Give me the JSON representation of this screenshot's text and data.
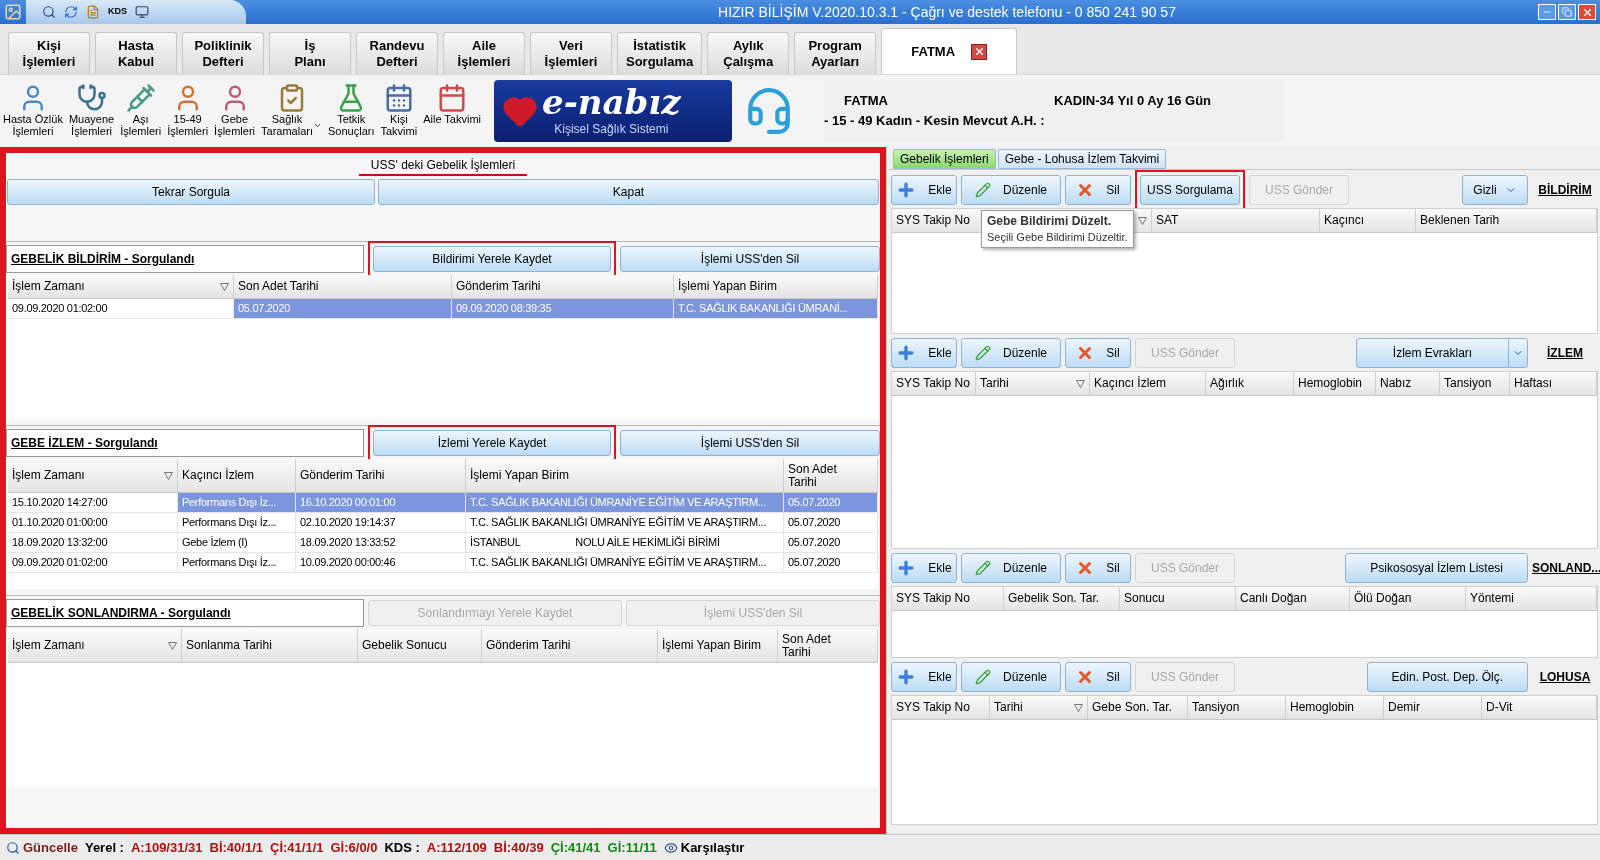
{
  "title_bar": {
    "title": "HIZIR BİLİŞİM V.2020.10.3.1 - Çağrı ve destek telefonu - 0 850 241 90 57",
    "quick_label": "KDS"
  },
  "menu_tabs": [
    {
      "label": "Kişi\nİşlemleri",
      "selected": false
    },
    {
      "label": "Hasta\nKabul",
      "selected": false
    },
    {
      "label": "Poliklinik\nDefteri",
      "selected": false
    },
    {
      "label": "İş\nPlanı",
      "selected": false
    },
    {
      "label": "Randevu\nDefteri",
      "selected": false
    },
    {
      "label": "Aile\nİşlemleri",
      "selected": false
    },
    {
      "label": "Veri\nİşlemleri",
      "selected": false
    },
    {
      "label": "İstatistik\nSorgulama",
      "selected": false
    },
    {
      "label": "Aylık\nÇalışma",
      "selected": false
    },
    {
      "label": "Program\nAyarları",
      "selected": false
    },
    {
      "label": "FATMA",
      "selected": true,
      "closable": true
    }
  ],
  "toolbar": [
    {
      "label": "Hasta Özlük\nİşlemleri",
      "kind": "button"
    },
    {
      "label": "Muayene\nİşlemleri",
      "kind": "button"
    },
    {
      "label": "Aşı\nİşlemleri",
      "kind": "button"
    },
    {
      "label": "15-49\nİşlemleri",
      "kind": "button"
    },
    {
      "label": "Gebe\nİşlemleri",
      "kind": "button"
    },
    {
      "label": "Sağlık\nTaramaları",
      "kind": "dropdown"
    },
    {
      "label": "Tetkik\nSonuçları",
      "kind": "button"
    },
    {
      "label": "Kişi\nTakvimi",
      "kind": "button"
    },
    {
      "label": "Aile Takvimi",
      "kind": "button"
    }
  ],
  "banner": {
    "title": "e-nabız",
    "subtitle": "Kişisel Sağlık Sistemi"
  },
  "patient": {
    "name": "FATMA",
    "info": "KADIN-34 Yıl 0 Ay 16 Gün",
    "status": "- 15 - 49 Kadın - Kesin Mevcut A.H. :"
  },
  "left_panel": {
    "title": "USS' deki Gebelik İşlemleri",
    "highlighted": true,
    "buttons": [
      "Tekrar Sorgula",
      "Kapat"
    ],
    "sections": [
      {
        "title": "GEBELİK BİLDİRİM - Sorgulandı",
        "buttons": [
          {
            "label": "Bildirimi Yerele Kaydet",
            "disabled": false,
            "highlighted": true
          },
          {
            "label": "İşlemi USS'den Sil",
            "disabled": false,
            "highlighted": false
          }
        ],
        "columns": [
          {
            "label": "İşlem Zamanı",
            "sortable": true
          },
          {
            "label": "Son Adet Tarihi",
            "sortable": false
          },
          {
            "label": "Gönderim Tarihi",
            "sortable": false
          },
          {
            "label": "İşlemi Yapan Birim",
            "sortable": false
          }
        ],
        "rows": [
          {
            "selected": true,
            "cells": [
              "09.09.2020 01:02:00",
              "05.07.2020",
              "09.09.2020 08:39:35",
              "T.C. SAĞLIK BAKANLIĞI ÜMRANİ..."
            ]
          }
        ]
      },
      {
        "title": "GEBE İZLEM - Sorgulandı",
        "buttons": [
          {
            "label": "İzlemi Yerele Kaydet",
            "disabled": false,
            "highlighted": true
          },
          {
            "label": "İşlemi USS'den Sil",
            "disabled": false,
            "highlighted": false
          }
        ],
        "columns": [
          {
            "label": "İşlem Zamanı",
            "sortable": true
          },
          {
            "label": "Kaçıncı İzlem",
            "sortable": false
          },
          {
            "label": "Gönderim Tarihi",
            "sortable": false
          },
          {
            "label": "İşlemi Yapan Birim",
            "sortable": false
          },
          {
            "label": "Son Adet\nTarihi",
            "sortable": false
          }
        ],
        "rows": [
          {
            "selected": true,
            "cells": [
              "15.10.2020 14:27:00",
              "Performans Dışı İz...",
              "16.10.2020 00:01:00",
              "T.C. SAĞLIK BAKANLIĞI ÜMRANİYE EĞİTİM VE ARAŞTIRM...",
              "05.07.2020"
            ]
          },
          {
            "selected": false,
            "cells": [
              "01.10.2020 01:00:00",
              "Performans Dışı İz...",
              "02.10.2020 19:14:37",
              "T.C. SAĞLIK BAKANLIĞI ÜMRANİYE EĞİTİM VE ARAŞTIRM...",
              "05.07.2020"
            ]
          },
          {
            "selected": false,
            "cells": [
              "18.09.2020 13:32:00",
              "Gebe İzlem (I)",
              "18.09.2020 13:33:52",
              "İSTANBUL                    NOLU AİLE HEKİMLİĞİ BİRİMİ",
              "05.07.2020"
            ]
          },
          {
            "selected": false,
            "cells": [
              "09.09.2020 01:02:00",
              "Performans Dışı İz...",
              "10.09.2020 00:00:46",
              "T.C. SAĞLIK BAKANLIĞI ÜMRANİYE EĞİTİM VE ARAŞTIRM...",
              "05.07.2020"
            ]
          }
        ]
      },
      {
        "title": "GEBELİK SONLANDIRMA - Sorgulandı",
        "buttons": [
          {
            "label": "Sonlandırmayı Yerele Kaydet",
            "disabled": true,
            "highlighted": false
          },
          {
            "label": "İşlemi USS'den Sil",
            "disabled": true,
            "highlighted": false
          }
        ],
        "columns": [
          {
            "label": "İşlem Zamanı",
            "sortable": true
          },
          {
            "label": "Sonlanma Tarihi",
            "sortable": false
          },
          {
            "label": "Gebelik Sonucu",
            "sortable": false
          },
          {
            "label": "Gönderim Tarihi",
            "sortable": false
          },
          {
            "label": "İşlemi Yapan Birim",
            "sortable": false
          },
          {
            "label": "Son Adet\nTarihi",
            "sortable": false
          }
        ]
      }
    ]
  },
  "right_panel": {
    "tabs": [
      {
        "label": "Gebelik İşlemleri",
        "selected": true
      },
      {
        "label": "Gebe - Lohusa İzlem Takvimi",
        "selected": false
      }
    ],
    "tooltip": {
      "title": "Gebe Bildirimi Düzelt.",
      "text": "Seçili Gebe Bildirimi Düzeltir."
    },
    "sections": [
      {
        "title": "BİLDİRİM",
        "actions": [
          {
            "label": "Ekle",
            "kind": "add",
            "disabled": false,
            "highlighted": false
          },
          {
            "label": "Düzenle",
            "kind": "edit",
            "disabled": false,
            "highlighted": false
          },
          {
            "label": "Sil",
            "kind": "delete",
            "disabled": false,
            "highlighted": false
          },
          {
            "label": "USS Sorgulama",
            "kind": "button",
            "disabled": false,
            "highlighted": true
          },
          {
            "label": "USS Gönder",
            "kind": "button",
            "disabled": true,
            "highlighted": false
          }
        ],
        "extras": [
          {
            "label": "Gizli",
            "kind": "dropdown"
          }
        ],
        "columns": [
          {
            "label": "SYS Takip No",
            "sortable": false
          },
          {
            "sortable": true
          },
          {
            "label": "SAT",
            "sortable": false
          },
          {
            "label": "Kaçıncı",
            "sortable": false
          },
          {
            "label": "Beklenen Tarih",
            "sortable": false
          }
        ]
      },
      {
        "title": "İZLEM",
        "actions": [
          {
            "label": "Ekle",
            "kind": "add",
            "disabled": false,
            "highlighted": false
          },
          {
            "label": "Düzenle",
            "kind": "edit",
            "disabled": false,
            "highlighted": false
          },
          {
            "label": "Sil",
            "kind": "delete",
            "disabled": false,
            "highlighted": false
          },
          {
            "label": "USS Gönder",
            "kind": "button",
            "disabled": true,
            "highlighted": false
          }
        ],
        "extras": [
          {
            "label": "İzlem Evrakları",
            "kind": "split"
          }
        ],
        "columns": [
          {
            "label": "SYS Takip No",
            "sortable": false
          },
          {
            "label": "Tarihi",
            "sortable": true
          },
          {
            "label": "Kaçıncı İzlem",
            "sortable": false
          },
          {
            "label": "Ağırlık",
            "sortable": false
          },
          {
            "label": "Hemoglobin",
            "sortable": false
          },
          {
            "label": "Nabız",
            "sortable": false
          },
          {
            "label": "Tansiyon",
            "sortable": false
          },
          {
            "label": "Haftası",
            "sortable": false
          }
        ]
      },
      {
        "title": "SONLAND...",
        "actions": [
          {
            "label": "Ekle",
            "kind": "add",
            "disabled": false,
            "highlighted": false
          },
          {
            "label": "Düzenle",
            "kind": "edit",
            "disabled": false,
            "highlighted": false
          },
          {
            "label": "Sil",
            "kind": "delete",
            "disabled": false,
            "highlighted": false
          },
          {
            "label": "USS Gönder",
            "kind": "button",
            "disabled": true,
            "highlighted": false
          }
        ],
        "extras": [
          {
            "label": "Psikososyal İzlem Listesi",
            "kind": "button"
          }
        ],
        "columns": [
          {
            "label": "SYS Takip No",
            "sortable": false
          },
          {
            "label": "Gebelik Son. Tar.",
            "sortable": false
          },
          {
            "label": "Sonucu",
            "sortable": false
          },
          {
            "label": "Canlı Doğan",
            "sortable": false
          },
          {
            "label": "Ölü Doğan",
            "sortable": false
          },
          {
            "label": "Yöntemi",
            "sortable": false
          }
        ]
      },
      {
        "title": "LOHUSA",
        "actions": [
          {
            "label": "Ekle",
            "kind": "add",
            "disabled": false,
            "highlighted": false
          },
          {
            "label": "Düzenle",
            "kind": "edit",
            "disabled": false,
            "highlighted": false
          },
          {
            "label": "Sil",
            "kind": "delete",
            "disabled": false,
            "highlighted": false
          },
          {
            "label": "USS Gönder",
            "kind": "button",
            "disabled": true,
            "highlighted": false
          }
        ],
        "extras": [
          {
            "label": "Edin. Post. Dep. Ölç.",
            "kind": "button"
          }
        ],
        "columns": [
          {
            "label": "SYS Takip No",
            "sortable": false
          },
          {
            "label": "Tarihi",
            "sortable": true
          },
          {
            "label": "Gebe Son. Tar.",
            "sortable": false
          },
          {
            "label": "Tansiyon",
            "sortable": false
          },
          {
            "label": "Hemoglobin",
            "sortable": false
          },
          {
            "label": "Demir",
            "sortable": false
          },
          {
            "label": "D-Vit",
            "sortable": false
          }
        ]
      }
    ]
  },
  "status_bar": [
    {
      "text": "Güncelle",
      "color": "#7a1c1c",
      "kind": "refresh"
    },
    {
      "text": "Yerel :",
      "color": "#000000"
    },
    {
      "text": "A:109/31/31",
      "color": "#b01010"
    },
    {
      "text": "Bİ:40/1/1",
      "color": "#b01010"
    },
    {
      "text": "Çİ:41/1/1",
      "color": "#b01010"
    },
    {
      "text": "Gİ:6/0/0",
      "color": "#b01010"
    },
    {
      "text": "KDS :",
      "color": "#000000"
    },
    {
      "text": "A:112/109",
      "color": "#b01010"
    },
    {
      "text": "Bİ:40/39",
      "color": "#b01010"
    },
    {
      "text": "Çİ:41/41",
      "color": "#118a11"
    },
    {
      "text": "Gİ:11/11",
      "color": "#118a11"
    },
    {
      "text": "Karşılaştır",
      "color": "#000000",
      "kind": "compare"
    }
  ]
}
